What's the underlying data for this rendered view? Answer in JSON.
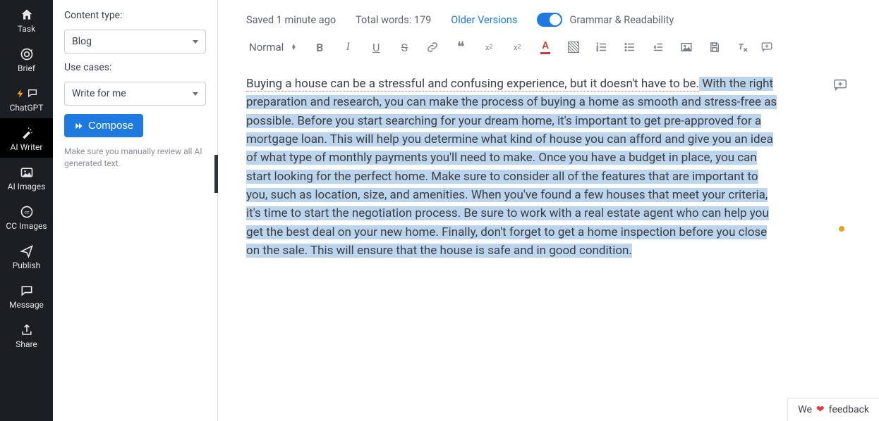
{
  "nav": {
    "items": [
      {
        "label": "Task"
      },
      {
        "label": "Brief"
      },
      {
        "label": "ChatGPT"
      },
      {
        "label": "AI Writer"
      },
      {
        "label": "AI Images"
      },
      {
        "label": "CC Images"
      },
      {
        "label": "Publish"
      },
      {
        "label": "Message"
      },
      {
        "label": "Share"
      }
    ]
  },
  "panel": {
    "content_type_label": "Content type:",
    "content_type_value": "Blog",
    "use_cases_label": "Use cases:",
    "use_cases_value": "Write for me",
    "compose_label": "Compose",
    "hint": "Make sure you manually review all AI generated text."
  },
  "topbar": {
    "saved": "Saved 1 minute ago",
    "word_count": "Total words: 179",
    "older_versions": "Older Versions",
    "grammar_label": "Grammar & Readability"
  },
  "toolbar": {
    "paragraph_style": "Normal"
  },
  "editor": {
    "plain": "Buying a house can be a stressful and confusing experience, but it doesn't have to be.",
    "selected": " With the right preparation and research, you can make the process of buying a home as smooth and stress-free as possible. Before you start searching for your dream home, it's important to get pre-approved for a mortgage loan. This will help you determine what kind of house you can afford and give you an idea of what type of monthly payments you'll need to make. Once you have a budget in place, you can start looking for the perfect home. Make sure to consider all of the features that are important to you, such as location, size, and amenities. When you've found a few houses that meet your criteria, it's time to start the negotiation process. Be sure to work with a real estate agent who can help you get the best deal on your new home. Finally, don't forget to get a home inspection before you close on the sale. This will ensure that the house is safe and in good condition."
  },
  "feedback": {
    "prefix": "We",
    "suffix": "feedback"
  }
}
